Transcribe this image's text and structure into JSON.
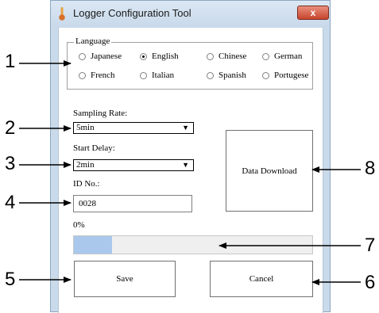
{
  "window": {
    "title": "Logger Configuration Tool",
    "close_glyph": "x"
  },
  "language_group": {
    "legend": "Language",
    "options": [
      "Japanese",
      "English",
      "Chinese",
      "German",
      "French",
      "Italian",
      "Spanish",
      "Portugese"
    ],
    "selected": "English"
  },
  "sampling_rate": {
    "label": "Sampling Rate:",
    "value": "5min"
  },
  "start_delay": {
    "label": "Start Delay:",
    "value": "2min"
  },
  "id_no": {
    "label": "ID No.:",
    "value": "0028"
  },
  "progress": {
    "label": "0%",
    "fill_fraction": 0.16
  },
  "buttons": {
    "data_download": "Data Download",
    "save": "Save",
    "cancel": "Cancel"
  },
  "callouts": [
    "1",
    "2",
    "3",
    "4",
    "5",
    "6",
    "7",
    "8"
  ],
  "icons": {
    "app": "thermometer-icon",
    "dropdown": "triangle-down-icon",
    "arrow": "arrow-icon"
  },
  "colors": {
    "title_bar": "#c8d9ea",
    "close_button": "#c8452d",
    "progress_fill": "#a9c8ec"
  }
}
